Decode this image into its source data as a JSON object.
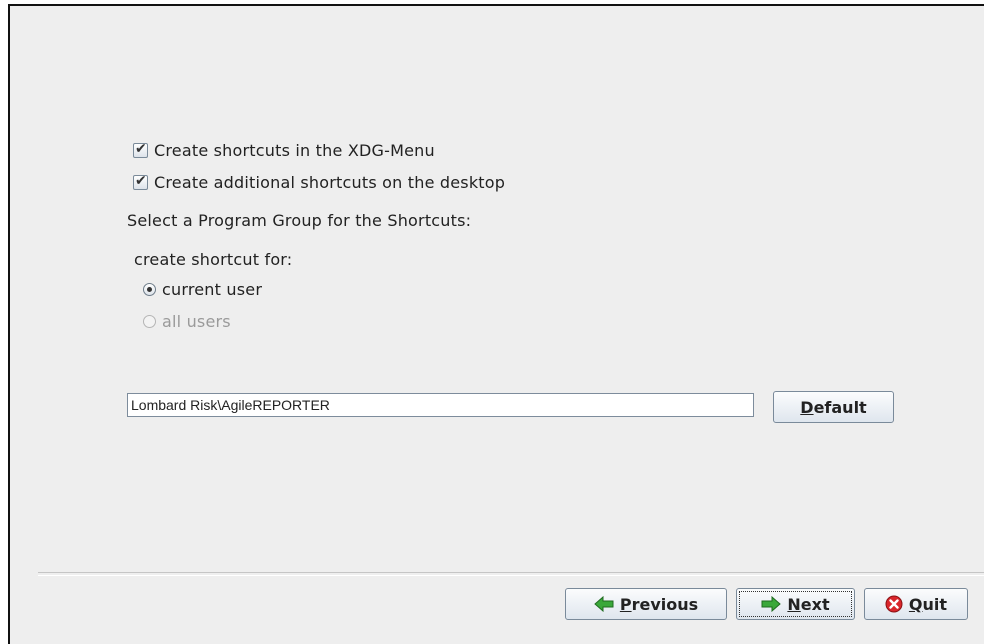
{
  "options": {
    "xdg_menu": {
      "label": "Create shortcuts in the XDG-Menu",
      "checked": true
    },
    "desktop": {
      "label": "Create additional shortcuts on the desktop",
      "checked": true
    }
  },
  "program_group": {
    "heading": "Select a Program Group for the Shortcuts:",
    "create_for_label": "create shortcut for:",
    "radios": [
      {
        "label": "current user",
        "selected": true,
        "enabled": true
      },
      {
        "label": "all users",
        "selected": false,
        "enabled": false
      }
    ],
    "path_value": "Lombard Risk\\AgileREPORTER",
    "default_button": {
      "mnemonic": "D",
      "rest": "efault"
    }
  },
  "nav": {
    "previous": {
      "mnemonic": "P",
      "rest": "revious",
      "icon": "arrow-left-icon"
    },
    "next": {
      "mnemonic": "N",
      "rest": "ext",
      "icon": "arrow-right-icon"
    },
    "quit": {
      "mnemonic": "Q",
      "rest": "uit",
      "icon": "stop-icon"
    }
  },
  "colors": {
    "background": "#eeeeee",
    "arrow_green": "#3aa83a",
    "quit_red": "#d9262b"
  }
}
